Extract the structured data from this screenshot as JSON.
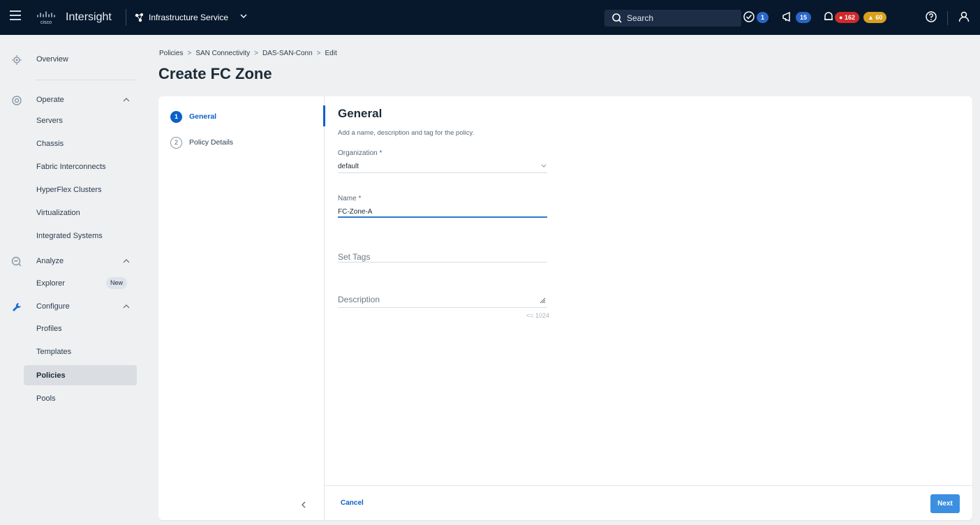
{
  "header": {
    "brand": "Intersight",
    "cisco_logo": "cisco",
    "service_name": "Infrastructure Service",
    "search_label": "Search",
    "tasks_count": "1",
    "announcements_count": "15",
    "alarms_critical": "162",
    "alarms_warning": "60",
    "icons": [
      "menu-icon",
      "infrastructure-service-icon",
      "search-icon",
      "check-circle-icon",
      "megaphone-icon",
      "bell-icon",
      "help-icon",
      "user-icon"
    ],
    "colors": {
      "bar": "#07182d",
      "critical": "#cf2a2a",
      "warning": "#d8a01b",
      "info": "#2b65c6"
    }
  },
  "sidebar": {
    "overview": "Overview",
    "operate": {
      "label": "Operate",
      "items": [
        "Servers",
        "Chassis",
        "Fabric Interconnects",
        "HyperFlex Clusters",
        "Virtualization",
        "Integrated Systems"
      ]
    },
    "analyze": {
      "label": "Analyze",
      "items": [
        "Explorer"
      ],
      "explorer_badge": "New"
    },
    "configure": {
      "label": "Configure",
      "items": [
        "Profiles",
        "Templates",
        "Policies",
        "Pools"
      ]
    },
    "selected": "Policies"
  },
  "breadcrumb": [
    "Policies",
    "SAN Connectivity",
    "DAS-SAN-Conn",
    "Edit"
  ],
  "breadcrumb_sep": ">",
  "page_title": "Create FC Zone",
  "wizard": {
    "steps": [
      {
        "num": "1",
        "label": "General"
      },
      {
        "num": "2",
        "label": "Policy Details"
      }
    ],
    "active_step": "General"
  },
  "form": {
    "title": "General",
    "subtitle": "Add a name, description and tag for the policy.",
    "organization_label": "Organization *",
    "organization_value": "default",
    "name_label": "Name *",
    "name_value": "FC-Zone-A",
    "tags_placeholder": "Set Tags",
    "description_placeholder": "Description",
    "description_limit": "<= 1024"
  },
  "footer": {
    "cancel": "Cancel",
    "next": "Next"
  }
}
